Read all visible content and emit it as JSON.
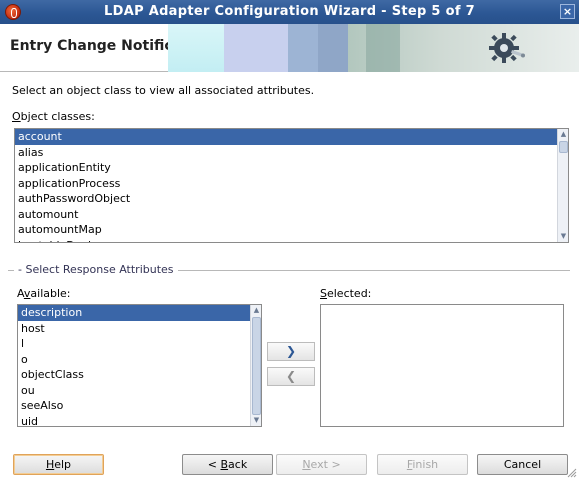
{
  "window": {
    "title": "LDAP Adapter Configuration Wizard - Step 5 of 7",
    "close_glyph": "×"
  },
  "header": {
    "title": "Entry Change Notification",
    "banner_icon": "gear-plug-icon"
  },
  "prompt": "Select an object class to view all associated attributes.",
  "object_classes": {
    "label_prefix": "O",
    "label_rest": "bject classes:",
    "items": [
      "account",
      "alias",
      "applicationEntity",
      "applicationProcess",
      "authPasswordObject",
      "automount",
      "automountMap",
      "bootableDevice"
    ],
    "selected": "account"
  },
  "response_group": {
    "label": "Select Response Attributes"
  },
  "available": {
    "label_a": "A",
    "label_v": "v",
    "label_rest": "ailable:",
    "items": [
      "description",
      "host",
      "l",
      "o",
      "objectClass",
      "ou",
      "seeAlso",
      "uid"
    ],
    "selected": "description"
  },
  "selected_list": {
    "label_prefix": "S",
    "label_rest": "elected:",
    "items": []
  },
  "transfer": {
    "add_glyph": "❯",
    "remove_glyph": "❮",
    "add_icon": "add-arrow-icon",
    "remove_icon": "remove-arrow-icon"
  },
  "buttons": {
    "help": {
      "prefix": "H",
      "rest": "elp"
    },
    "back": {
      "pre": "< ",
      "u": "B",
      "rest": "ack"
    },
    "next": {
      "u": "N",
      "rest": "ext >"
    },
    "finish": {
      "u": "F",
      "rest": "inish"
    },
    "cancel": "Cancel"
  },
  "colors": {
    "selection": "#3a66a8",
    "titlebar": "#2c5794",
    "focus_border": "#e0a35a"
  }
}
